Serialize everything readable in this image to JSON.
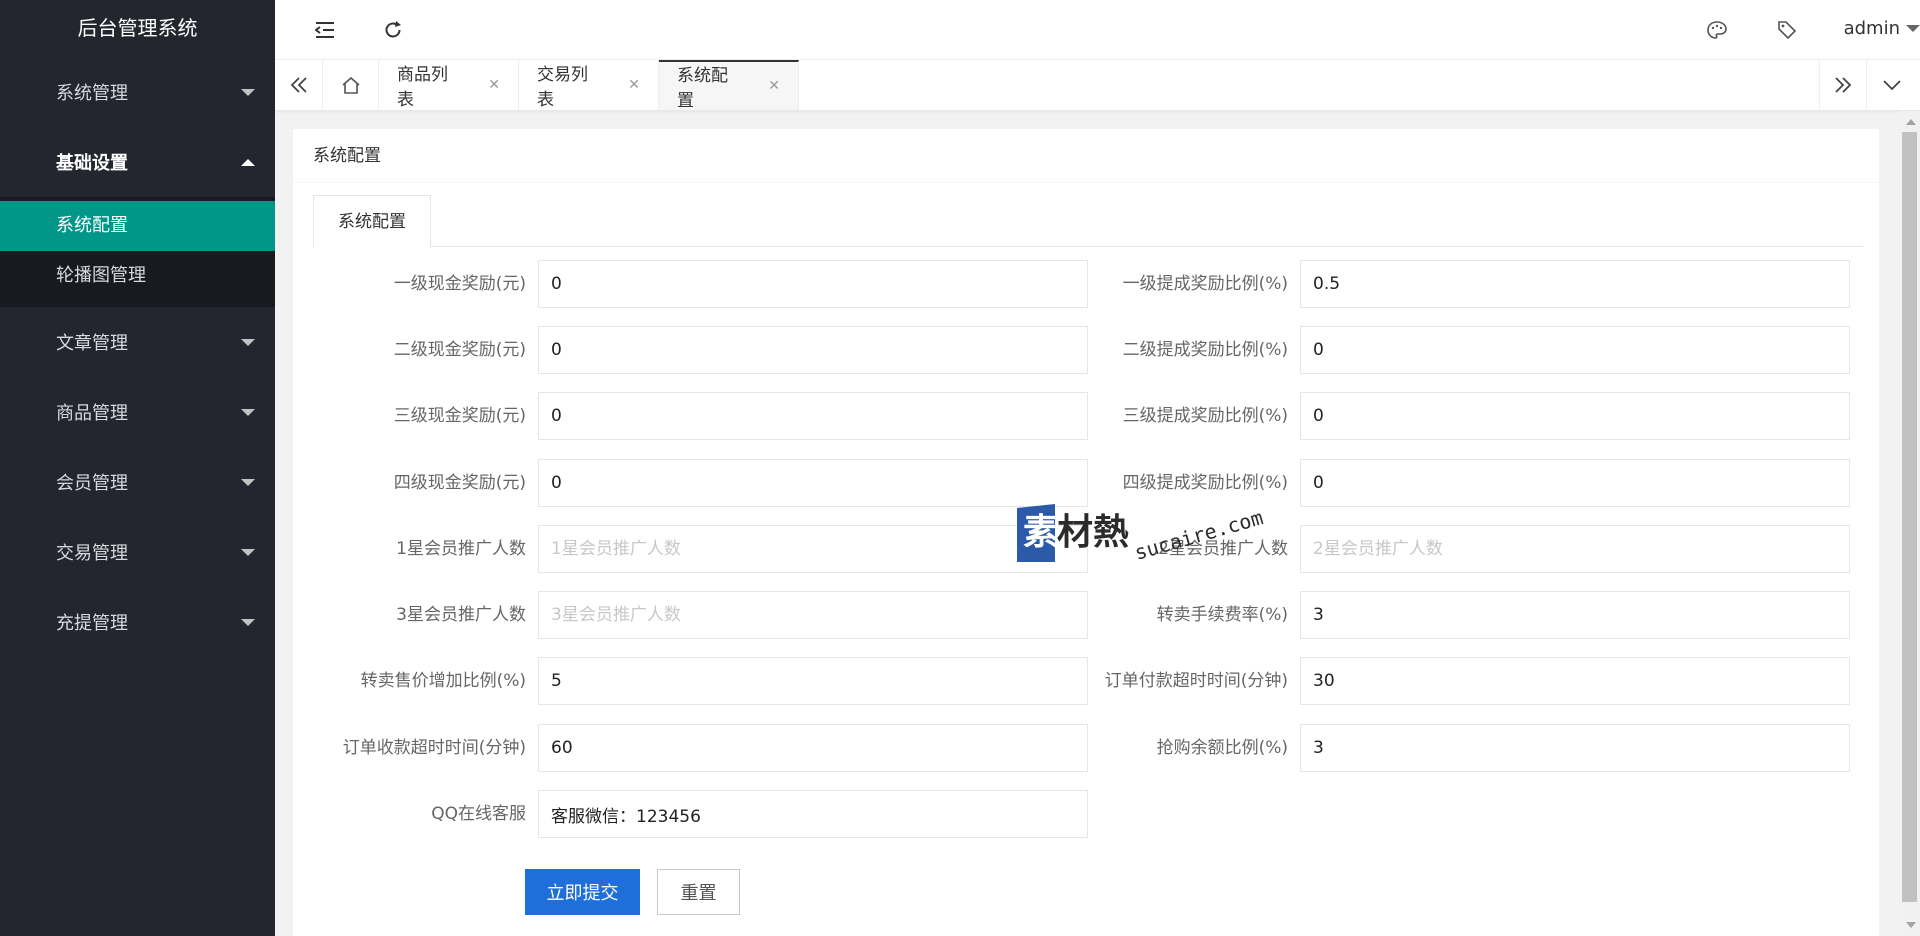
{
  "app": {
    "title": "后台管理系统"
  },
  "sidebar": {
    "groups": [
      {
        "label": "系统管理",
        "open": false
      },
      {
        "label": "基础设置",
        "open": true,
        "items": [
          {
            "label": "系统配置",
            "active": true
          },
          {
            "label": "轮播图管理",
            "active": false
          }
        ]
      },
      {
        "label": "文章管理",
        "open": false
      },
      {
        "label": "商品管理",
        "open": false
      },
      {
        "label": "会员管理",
        "open": false
      },
      {
        "label": "交易管理",
        "open": false
      },
      {
        "label": "充提管理",
        "open": false
      }
    ]
  },
  "header": {
    "user": "admin"
  },
  "tabs": [
    {
      "label": "商品列表",
      "active": false
    },
    {
      "label": "交易列表",
      "active": false
    },
    {
      "label": "系统配置",
      "active": true
    }
  ],
  "page": {
    "card_title": "系统配置",
    "inner_tab": "系统配置",
    "fields": [
      {
        "left_label": "一级现金奖励(元)",
        "left_value": "0",
        "left_placeholder": "",
        "right_label": "一级提成奖励比例(%)",
        "right_value": "0.5",
        "right_placeholder": ""
      },
      {
        "left_label": "二级现金奖励(元)",
        "left_value": "0",
        "left_placeholder": "",
        "right_label": "二级提成奖励比例(%)",
        "right_value": "0",
        "right_placeholder": ""
      },
      {
        "left_label": "三级现金奖励(元)",
        "left_value": "0",
        "left_placeholder": "",
        "right_label": "三级提成奖励比例(%)",
        "right_value": "0",
        "right_placeholder": ""
      },
      {
        "left_label": "四级现金奖励(元)",
        "left_value": "0",
        "left_placeholder": "",
        "right_label": "四级提成奖励比例(%)",
        "right_value": "0",
        "right_placeholder": ""
      },
      {
        "left_label": "1星会员推广人数",
        "left_value": "",
        "left_placeholder": "1星会员推广人数",
        "right_label": "2星会员推广人数",
        "right_value": "",
        "right_placeholder": "2星会员推广人数"
      },
      {
        "left_label": "3星会员推广人数",
        "left_value": "",
        "left_placeholder": "3星会员推广人数",
        "right_label": "转卖手续费率(%)",
        "right_value": "3",
        "right_placeholder": ""
      },
      {
        "left_label": "转卖售价增加比例(%)",
        "left_value": "5",
        "left_placeholder": "",
        "right_label": "订单付款超时时间(分钟)",
        "right_value": "30",
        "right_placeholder": ""
      },
      {
        "left_label": "订单收款超时时间(分钟)",
        "left_value": "60",
        "left_placeholder": "",
        "right_label": "抢购余额比例(%)",
        "right_value": "3",
        "right_placeholder": ""
      }
    ],
    "qq": {
      "label": "QQ在线客服",
      "value": "客服微信：123456"
    },
    "buttons": {
      "submit": "立即提交",
      "reset": "重置"
    }
  },
  "watermark": {
    "text1": "素材熱",
    "text2": "sucaire.com"
  },
  "colors": {
    "sidebar_bg": "#23262e",
    "active_item": "#009688",
    "primary_button": "#1e6fd9"
  }
}
